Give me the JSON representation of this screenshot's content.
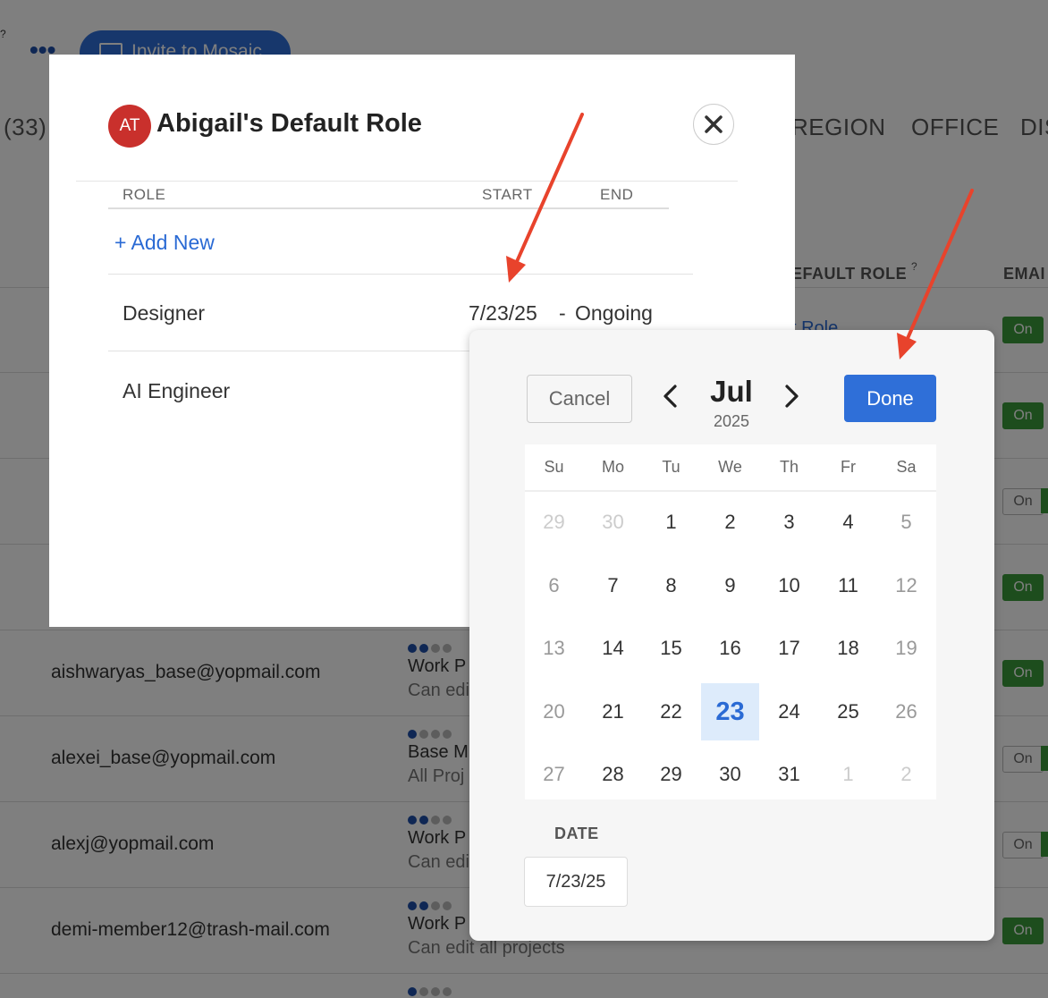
{
  "background": {
    "count_label": "(33)",
    "help_mark": "?",
    "invite_button": "Invite to Mosaic",
    "header_tabs": [
      "REGION",
      "OFFICE",
      "DIS"
    ],
    "column_headers": {
      "default_role": "EFAULT ROLE",
      "help": "?",
      "email": "EMAI"
    },
    "partial_role_text": "t Role",
    "toggle_label": "On",
    "rows": [
      {
        "email": "aishwaryas_base@yopmail.com",
        "perm_title": "Work P",
        "perm_sub": "Can edi",
        "level": 2
      },
      {
        "email": "alexei_base@yopmail.com",
        "perm_title": "Base M",
        "perm_sub": "All Proj",
        "level": 1
      },
      {
        "email": "alexj@yopmail.com",
        "perm_title": "Work P",
        "perm_sub": "Can edi",
        "level": 2
      },
      {
        "email": "demi-member12@trash-mail.com",
        "perm_title": "Work P",
        "perm_sub": "Can edit all projects",
        "level": 2
      }
    ]
  },
  "modal": {
    "avatar_initials": "AT",
    "title": "Abigail's Default Role",
    "close_icon": "close-icon",
    "columns": {
      "role": "ROLE",
      "start": "START",
      "end": "END"
    },
    "add_new": "+ Add New",
    "roles": [
      {
        "name": "Designer",
        "start": "7/23/25",
        "separator": "-",
        "end": "Ongoing"
      },
      {
        "name": "AI Engineer"
      }
    ]
  },
  "picker": {
    "cancel": "Cancel",
    "done": "Done",
    "month": "Jul",
    "year": "2025",
    "weekdays": [
      "Su",
      "Mo",
      "Tu",
      "We",
      "Th",
      "Fr",
      "Sa"
    ],
    "weeks": [
      [
        "29",
        "30",
        "1",
        "2",
        "3",
        "4",
        "5"
      ],
      [
        "6",
        "7",
        "8",
        "9",
        "10",
        "11",
        "12"
      ],
      [
        "13",
        "14",
        "15",
        "16",
        "17",
        "18",
        "19"
      ],
      [
        "20",
        "21",
        "22",
        "23",
        "24",
        "25",
        "26"
      ],
      [
        "27",
        "28",
        "29",
        "30",
        "31",
        "1",
        "2"
      ]
    ],
    "selected_day": "23",
    "date_label": "DATE",
    "date_value": "7/23/25"
  },
  "colors": {
    "accent": "#2f6fd8",
    "avatar": "#c9302c",
    "annotation_arrow": "#e8432c",
    "toggle_on": "#3a9b3a"
  }
}
